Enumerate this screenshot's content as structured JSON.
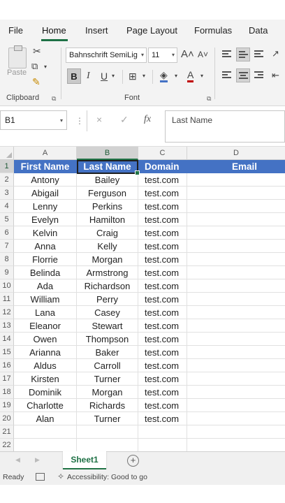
{
  "ribbon_tabs": [
    "File",
    "Home",
    "Insert",
    "Page Layout",
    "Formulas",
    "Data"
  ],
  "active_tab": "Home",
  "clipboard": {
    "paste_label": "Paste",
    "group_label": "Clipboard"
  },
  "font": {
    "name": "Bahnschrift SemiLig",
    "size": "11",
    "group_label": "Font",
    "bold": "B",
    "italic": "I",
    "underline": "U"
  },
  "formula_bar": {
    "name_box": "B1",
    "cancel_icon": "×",
    "enter_icon": "✓",
    "fx_icon": "fx",
    "content": "Last Name"
  },
  "columns": [
    "A",
    "B",
    "C",
    "D"
  ],
  "header_row": {
    "first_name": "First Name",
    "last_name": "Last Name",
    "domain": "Domain",
    "email": "Email"
  },
  "rows": [
    {
      "first": "Antony",
      "last": "Bailey",
      "domain": "test.com"
    },
    {
      "first": "Abigail",
      "last": "Ferguson",
      "domain": "test.com"
    },
    {
      "first": "Lenny",
      "last": "Perkins",
      "domain": "test.com"
    },
    {
      "first": "Evelyn",
      "last": "Hamilton",
      "domain": "test.com"
    },
    {
      "first": "Kelvin",
      "last": "Craig",
      "domain": "test.com"
    },
    {
      "first": "Anna",
      "last": "Kelly",
      "domain": "test.com"
    },
    {
      "first": "Florrie",
      "last": "Morgan",
      "domain": "test.com"
    },
    {
      "first": "Belinda",
      "last": "Armstrong",
      "domain": "test.com"
    },
    {
      "first": "Ada",
      "last": "Richardson",
      "domain": "test.com"
    },
    {
      "first": "William",
      "last": "Perry",
      "domain": "test.com"
    },
    {
      "first": "Lana",
      "last": "Casey",
      "domain": "test.com"
    },
    {
      "first": "Eleanor",
      "last": "Stewart",
      "domain": "test.com"
    },
    {
      "first": "Owen",
      "last": "Thompson",
      "domain": "test.com"
    },
    {
      "first": "Arianna",
      "last": "Baker",
      "domain": "test.com"
    },
    {
      "first": "Aldus",
      "last": "Carroll",
      "domain": "test.com"
    },
    {
      "first": "Kirsten",
      "last": "Turner",
      "domain": "test.com"
    },
    {
      "first": "Dominik",
      "last": "Morgan",
      "domain": "test.com"
    },
    {
      "first": "Charlotte",
      "last": "Richards",
      "domain": "test.com"
    },
    {
      "first": "Alan",
      "last": "Turner",
      "domain": "test.com"
    }
  ],
  "empty_row_numbers": [
    "21",
    "22"
  ],
  "sheet_tab": "Sheet1",
  "add_sheet": "+",
  "status": {
    "ready": "Ready",
    "accessibility": "Accessibility: Good to go"
  },
  "colors": {
    "header_fill": "#4472c4",
    "accent": "#217346"
  }
}
